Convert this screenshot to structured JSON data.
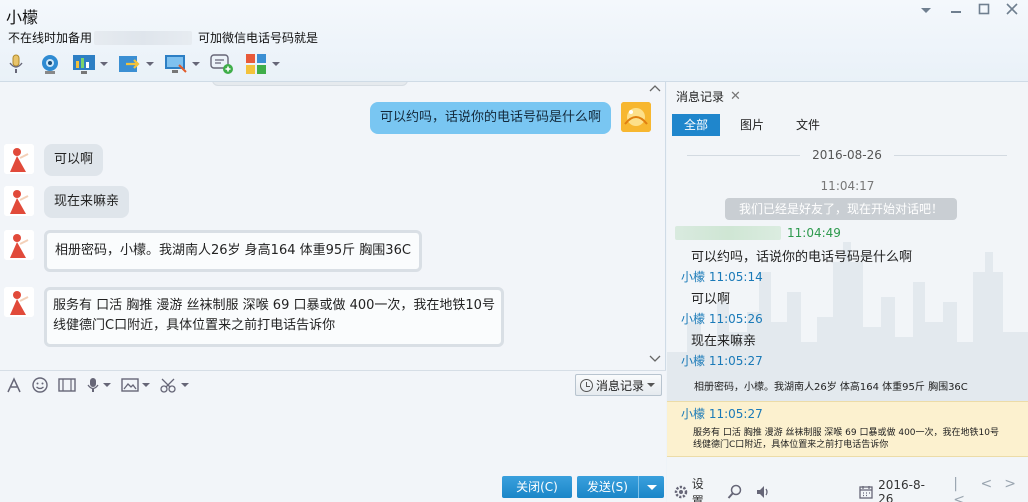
{
  "window": {
    "contact_name": "小檬",
    "status_prefix": "不在线时加备用",
    "status_suffix": "可加微信电话号码就是"
  },
  "toolbar": {
    "items": [
      {
        "icon": "microphone-icon"
      },
      {
        "icon": "webcam-icon"
      },
      {
        "icon": "screen-share-icon"
      },
      {
        "icon": "file-transfer-icon"
      },
      {
        "icon": "remote-desktop-icon"
      },
      {
        "icon": "add-message-icon"
      },
      {
        "icon": "apps-icon"
      }
    ]
  },
  "chat": {
    "messages": [
      {
        "side": "right",
        "text": "可以约吗，话说你的电话号码是什么啊"
      },
      {
        "side": "left",
        "text": "可以啊"
      },
      {
        "side": "left",
        "text": "现在来嘛亲"
      },
      {
        "side": "left",
        "text": "相册密码，小檬。我湖南人26岁 身高164 体重95斤 胸围36C"
      },
      {
        "side": "left",
        "text_line1": "服务有 口活 胸推 漫游 丝袜制服 深喉 69 口暴或做 400一次，我在地铁10号",
        "text_line2": "线健德门C口附近，具体位置来之前打电话告诉你"
      }
    ]
  },
  "input_toolbar": {
    "history_label": "消息记录"
  },
  "actions": {
    "close_label": "关闭(C)",
    "send_label": "发送(S)"
  },
  "panel": {
    "tab_label": "消息记录",
    "filters": [
      "全部",
      "图片",
      "文件"
    ],
    "date": "2016-08-26",
    "first_time": "11:04:17",
    "system_notice": "我们已经是好友了，现在开始对话吧！",
    "entries": [
      {
        "sender": "",
        "time": "11:04:49",
        "text": "可以约吗，话说你的电话号码是什么啊"
      },
      {
        "sender": "小檬",
        "time": "11:05:14",
        "text": "可以啊"
      },
      {
        "sender": "小檬",
        "time": "11:05:26",
        "text": "现在来嘛亲"
      },
      {
        "sender": "小檬",
        "time": "11:05:27",
        "text": "相册密码，小檬。我湖南人26岁 体高164 体重95斤 胸围36C"
      },
      {
        "sender": "小檬",
        "time": "11:05:27",
        "text_line1": "服务有 口活 胸推 漫游 丝袜制服 深喉 69 口暴或做 400一次，我在地铁10号",
        "text_line2": "线健德门C口附近，具体位置来之前打电话告诉你"
      }
    ],
    "settings_label": "设置",
    "bottom_date": "2016-8-26"
  },
  "colors": {
    "accent": "#1f86cc",
    "bubble_right": "#79c6f2",
    "bubble_left": "#dfe5eb",
    "highlight": "#fcf1cf"
  }
}
